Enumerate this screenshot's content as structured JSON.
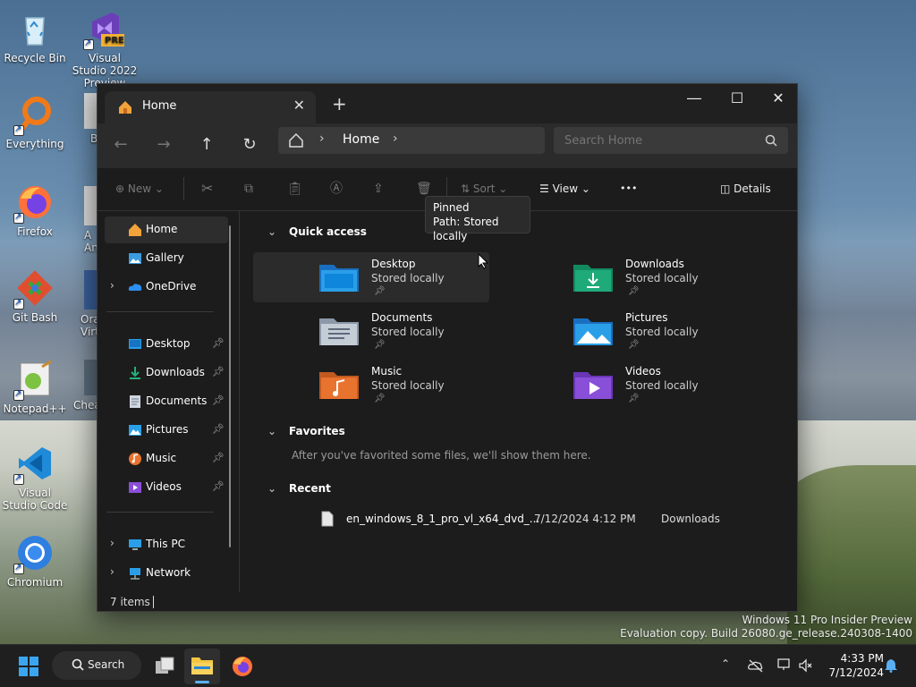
{
  "desktop": {
    "icons": [
      {
        "label": "Recycle Bin"
      },
      {
        "label": "Visual Studio 2022 Preview",
        "badge": "PRE"
      },
      {
        "label": "Everything"
      },
      {
        "label": "Firefox"
      },
      {
        "label": "Git Bash"
      },
      {
        "label": "Notepad++"
      },
      {
        "label": "Visual Studio Code"
      },
      {
        "label": "Chromium"
      }
    ],
    "partial_icons": [
      {
        "label": "B"
      },
      {
        "label": "A An"
      },
      {
        "label": "Ora Virt"
      },
      {
        "label": "Chea"
      }
    ]
  },
  "window": {
    "tab_title": "Home",
    "new_tab": "+",
    "address": {
      "segment": "Home"
    },
    "search_placeholder": "Search Home",
    "commands": {
      "new": "New",
      "sort": "Sort",
      "view": "View",
      "more": "•••",
      "details": "Details"
    },
    "sidebar": {
      "items": [
        {
          "label": "Home"
        },
        {
          "label": "Gallery"
        },
        {
          "label": "OneDrive"
        },
        {
          "label": "Desktop"
        },
        {
          "label": "Downloads"
        },
        {
          "label": "Documents"
        },
        {
          "label": "Pictures"
        },
        {
          "label": "Music"
        },
        {
          "label": "Videos"
        },
        {
          "label": "This PC"
        },
        {
          "label": "Network"
        }
      ]
    },
    "quick_access": {
      "title": "Quick access",
      "folders": [
        {
          "name": "Desktop",
          "sub": "Stored locally"
        },
        {
          "name": "Downloads",
          "sub": "Stored locally"
        },
        {
          "name": "Documents",
          "sub": "Stored locally"
        },
        {
          "name": "Pictures",
          "sub": "Stored locally"
        },
        {
          "name": "Music",
          "sub": "Stored locally"
        },
        {
          "name": "Videos",
          "sub": "Stored locally"
        }
      ]
    },
    "tooltip": {
      "line1": "Pinned",
      "line2": "Path: Stored locally"
    },
    "favorites": {
      "title": "Favorites",
      "empty_text": "After you've favorited some files, we'll show them here."
    },
    "recent": {
      "title": "Recent",
      "items": [
        {
          "name": "en_windows_8_1_pro_vl_x64_dvd_...",
          "date": "7/12/2024 4:12 PM",
          "location": "Downloads"
        }
      ]
    },
    "status": "7 items"
  },
  "watermark": {
    "line1": "Windows 11 Pro Insider Preview",
    "line2": "Evaluation copy. Build 26080.ge_release.240308-1400"
  },
  "taskbar": {
    "search_label": "Search",
    "time": "4:33 PM",
    "date": "7/12/2024"
  },
  "colors": {
    "accent": "#0078d4",
    "window_bg": "#1c1c1c",
    "folder_blue": "#2a9fe8",
    "folder_green": "#1faa7a",
    "folder_orange": "#e8732e",
    "folder_purple": "#8a4fd8"
  }
}
